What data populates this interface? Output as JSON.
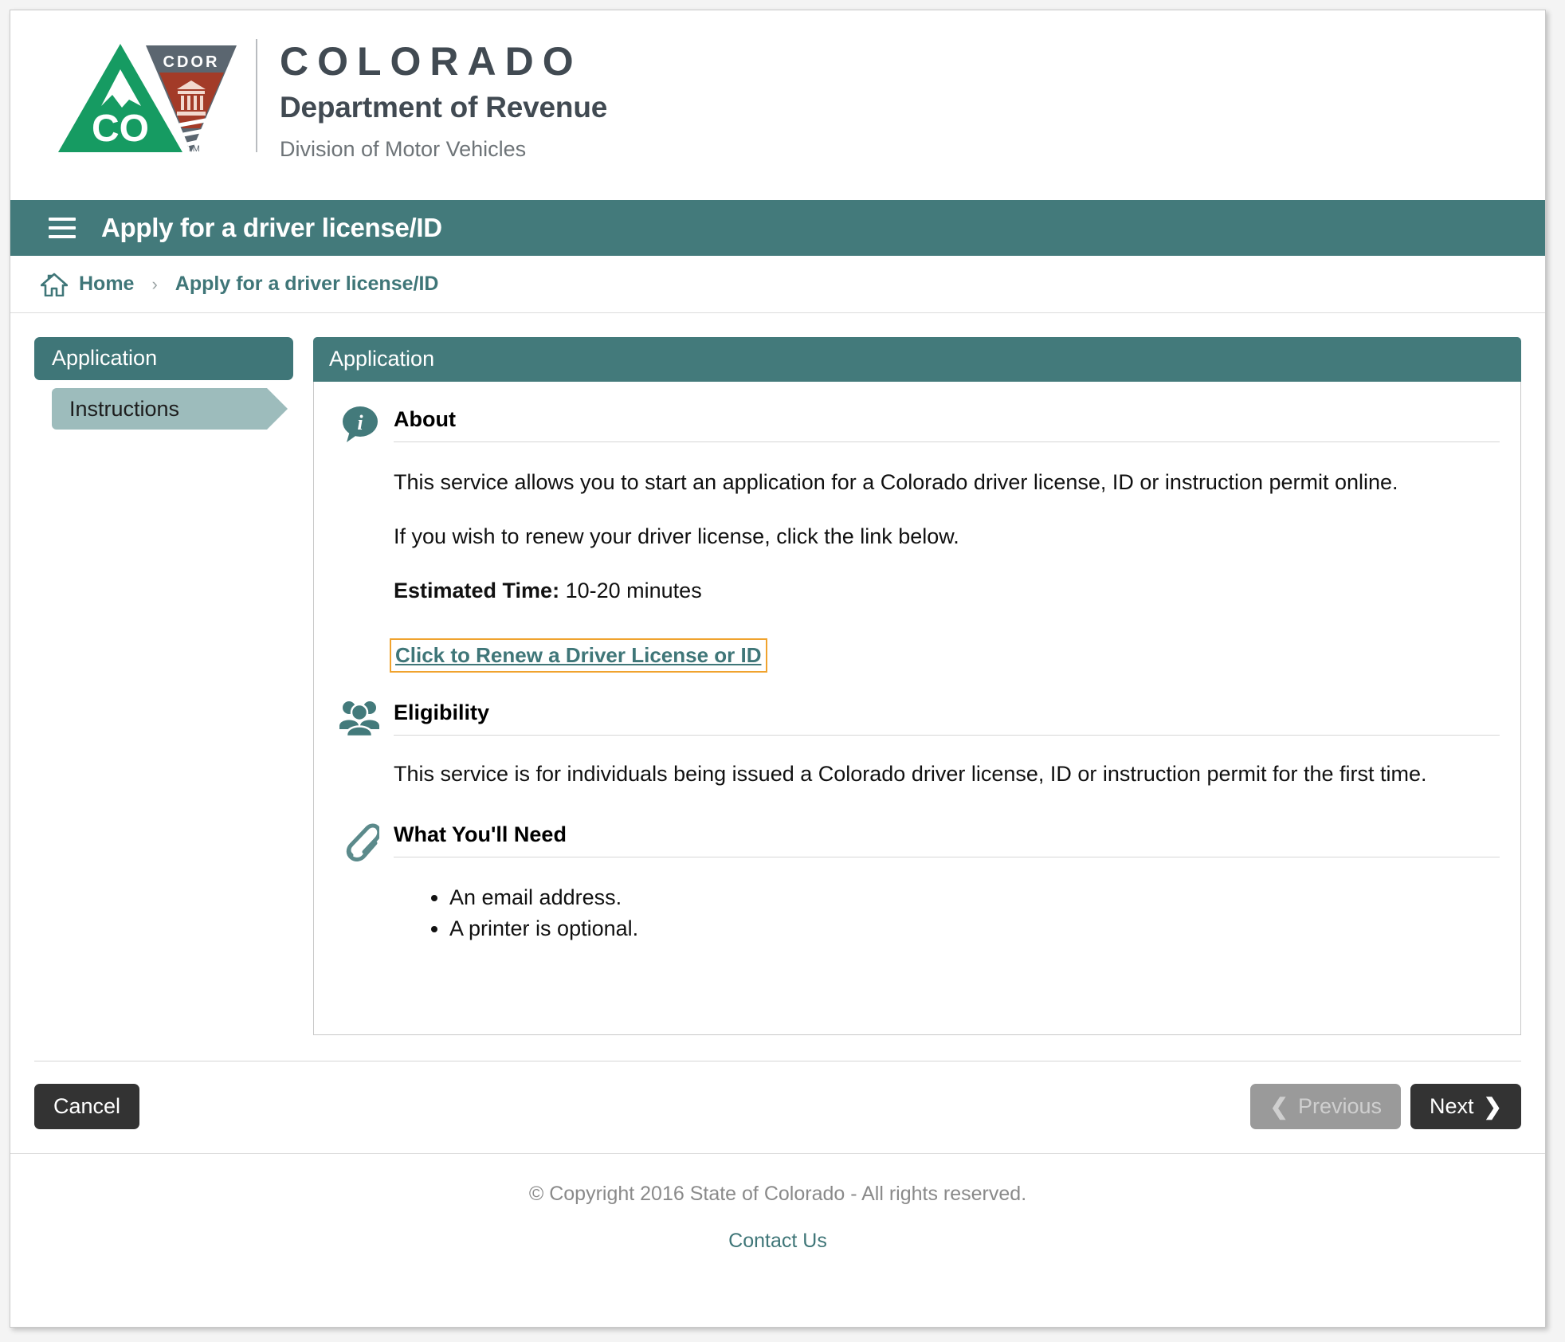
{
  "brand": {
    "state": "COLORADO",
    "department": "Department of Revenue",
    "division": "Division of Motor Vehicles",
    "logo_cdor_text": "CDOR",
    "logo_co_text": "CO",
    "logo_tm": "TM",
    "colors": {
      "green": "#169b62",
      "gray": "#5b6670",
      "red": "#a33b28",
      "teal": "#437a7b"
    }
  },
  "app_bar": {
    "menu_icon": "hamburger-menu-icon",
    "title": "Apply for a driver license/ID"
  },
  "breadcrumb": {
    "home_icon": "home-icon",
    "home_label": "Home",
    "separator": "›",
    "current_label": "Apply for a driver license/ID"
  },
  "sidebar": {
    "group_label": "Application",
    "items": [
      {
        "label": "Instructions",
        "active": true
      }
    ]
  },
  "panel": {
    "header": "Application",
    "sections": [
      {
        "icon": "info-speech-bubble-icon",
        "title": "About",
        "paragraphs": [
          "This service allows you to start an application for a Colorado driver license, ID or instruction permit online.",
          "If you wish to renew your driver license, click the link below."
        ],
        "estimated_time_label": "Estimated Time:",
        "estimated_time_value": "10-20 minutes",
        "link_label": "Click to Renew a Driver License or ID",
        "link_focus_color": "#f0a32e"
      },
      {
        "icon": "people-group-icon",
        "title": "Eligibility",
        "paragraphs": [
          "This service is for individuals being issued a Colorado driver license, ID or instruction permit for the first time."
        ]
      },
      {
        "icon": "paperclip-icon",
        "title": "What You'll Need",
        "items": [
          "An email address.",
          "A printer is optional."
        ]
      }
    ]
  },
  "buttons": {
    "cancel": "Cancel",
    "previous": "Previous",
    "next": "Next",
    "previous_icon": "chevron-left-icon",
    "next_icon": "chevron-right-icon",
    "previous_disabled": true
  },
  "footer": {
    "copyright": "© Copyright 2016 State of Colorado - All rights reserved.",
    "contact_label": "Contact Us"
  }
}
